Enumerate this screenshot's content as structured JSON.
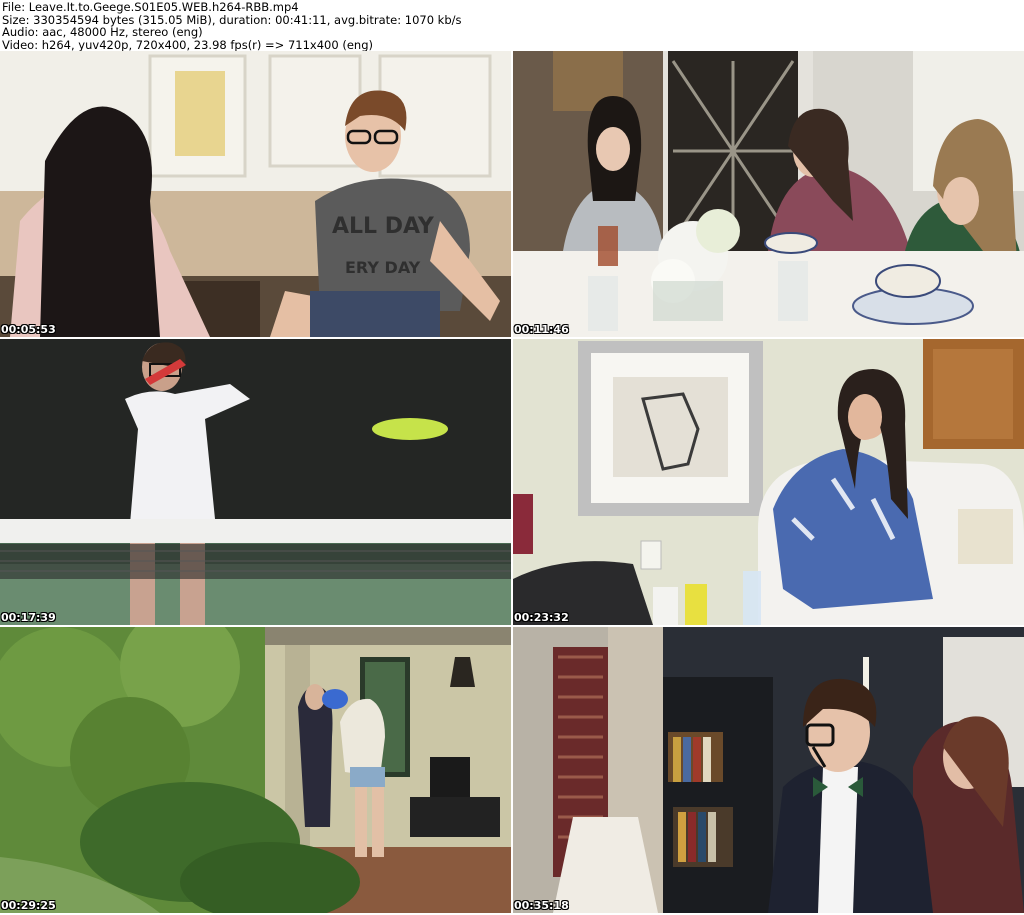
{
  "header": {
    "file": "File: Leave.It.to.Geege.S01E05.WEB.h264-RBB.mp4",
    "size": "Size: 330354594 bytes (315.05 MiB), duration: 00:41:11, avg.bitrate: 1070 kb/s",
    "audio": "Audio: aac, 48000 Hz, stereo (eng)",
    "video": "Video: h264, yuv420p, 720x400, 23.98 fps(r) => 711x400 (eng)"
  },
  "thumbnails": [
    {
      "timestamp": "00:05:53",
      "shirt_text_1": "ALL DAY",
      "shirt_text_2": "ERY DAY"
    },
    {
      "timestamp": "00:11:46"
    },
    {
      "timestamp": "00:17:39"
    },
    {
      "timestamp": "00:23:32"
    },
    {
      "timestamp": "00:29:25"
    },
    {
      "timestamp": "00:35:18"
    }
  ]
}
